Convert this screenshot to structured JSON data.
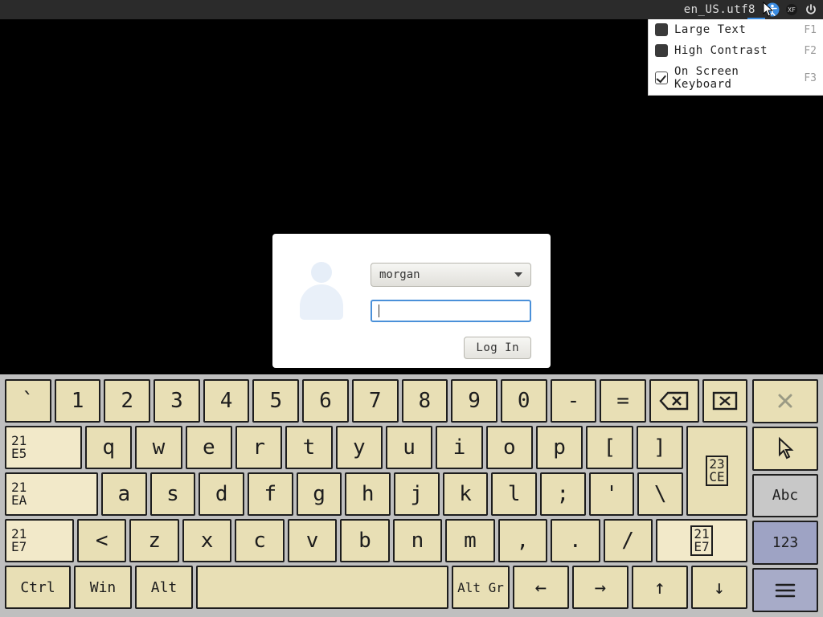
{
  "topbar": {
    "locale": "en_US.utf8",
    "icons": {
      "accessibility": "accessibility-icon",
      "contrast": "contrast-icon",
      "power": "power-icon"
    }
  },
  "a11y_menu": {
    "items": [
      {
        "label": "Large Text",
        "shortcut": "F1",
        "checked": false
      },
      {
        "label": "High Contrast",
        "shortcut": "F2",
        "checked": false
      },
      {
        "label": "On Screen Keyboard",
        "shortcut": "F3",
        "checked": true
      }
    ]
  },
  "login": {
    "selected_user": "morgan",
    "password_value": "",
    "login_button": "Log In"
  },
  "osk": {
    "row1": [
      "`",
      "1",
      "2",
      "3",
      "4",
      "5",
      "6",
      "7",
      "8",
      "9",
      "0",
      "-",
      "="
    ],
    "row1_actions": {
      "backspace": "backspace-icon",
      "delete": "delete-icon"
    },
    "row2_prefix_code": "21\nE5",
    "row2": [
      "q",
      "w",
      "e",
      "r",
      "t",
      "y",
      "u",
      "i",
      "o",
      "p",
      "[",
      "]"
    ],
    "enter_code": "23\nCE",
    "row3_prefix_code": "21\nEA",
    "row3": [
      "a",
      "s",
      "d",
      "f",
      "g",
      "h",
      "j",
      "k",
      "l",
      ";",
      "'",
      "\\"
    ],
    "row4_prefix_code": "21\nE7",
    "row4": [
      "<",
      "z",
      "x",
      "c",
      "v",
      "b",
      "n",
      "m",
      ",",
      ".",
      "/"
    ],
    "row4_suffix_code": "21\nE7",
    "row5": {
      "ctrl": "Ctrl",
      "win": "Win",
      "alt": "Alt",
      "altgr": "Alt Gr",
      "left": "←",
      "right": "→",
      "up": "↑",
      "down": "↓"
    },
    "right_col": {
      "hide": "✕",
      "abc": "Abc",
      "num": "123",
      "menu": "≡"
    }
  }
}
